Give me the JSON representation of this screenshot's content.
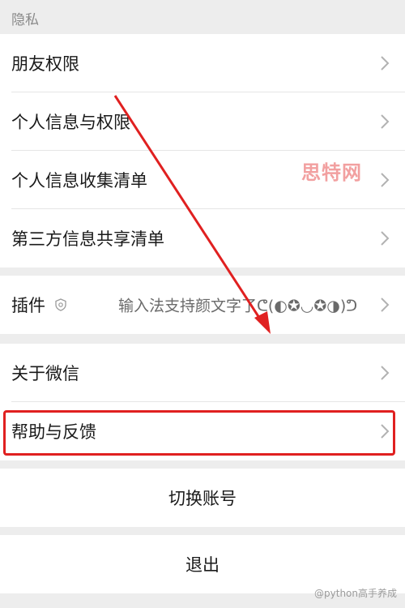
{
  "section_title": "隐私",
  "rows": {
    "friend_permissions": "朋友权限",
    "personal_info_permissions": "个人信息与权限",
    "personal_info_collection": "个人信息收集清单",
    "third_party_sharing": "第三方信息共享清单",
    "plugins": "插件",
    "plugins_subtitle": "输入法支持颜文字了ᕦ(◐✪◡✪◑)ᕤ",
    "about_wechat": "关于微信",
    "help_feedback": "帮助与反馈",
    "switch_account": "切换账号",
    "logout": "退出"
  },
  "watermarks": {
    "site": "思特网",
    "author": "@python高手养成"
  },
  "colors": {
    "highlight": "#e02020",
    "arrow": "#e02020",
    "background": "#ededed"
  }
}
